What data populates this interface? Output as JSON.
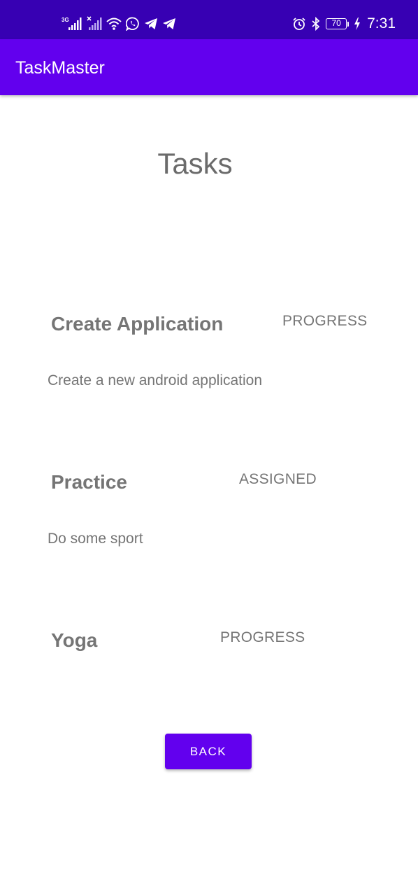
{
  "status_bar": {
    "network_label": "3G",
    "battery_level": "70",
    "time": "7:31",
    "left_icons": [
      "cellular-signal-icon",
      "no-sim-signal-icon",
      "wifi-icon",
      "whatsapp-icon",
      "telegram-icon",
      "telegram-icon"
    ],
    "right_icons": [
      "alarm-icon",
      "bluetooth-icon",
      "battery-icon",
      "charging-bolt-icon"
    ]
  },
  "app_bar": {
    "title": "TaskMaster",
    "color": "#6200ee",
    "status_bar_color": "#3700b3"
  },
  "page": {
    "heading": "Tasks"
  },
  "tasks": [
    {
      "title": "Create Application",
      "status": "PROGRESS",
      "description": "Create a new android application"
    },
    {
      "title": "Practice",
      "status": "ASSIGNED",
      "description": "Do some sport"
    },
    {
      "title": "Yoga",
      "status": "PROGRESS",
      "description": ""
    }
  ],
  "back_button": {
    "label": "BACK",
    "color": "#6200ee"
  }
}
